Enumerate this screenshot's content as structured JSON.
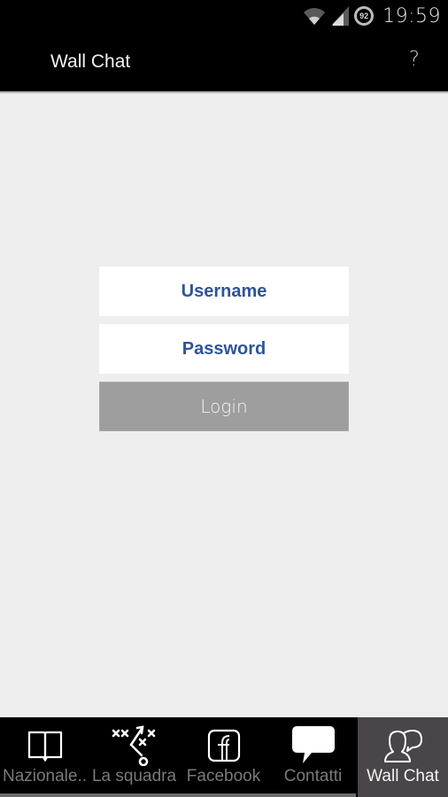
{
  "status_bar": {
    "time": "19:59",
    "battery_level": "92",
    "icons": [
      "wifi-icon",
      "cell-signal-icon",
      "battery-icon"
    ]
  },
  "action_bar": {
    "title": "Wall Chat",
    "help_label": "?"
  },
  "login": {
    "username_placeholder": "Username",
    "password_placeholder": "Password",
    "username_value": "",
    "password_value": "",
    "login_label": "Login"
  },
  "tabs": [
    {
      "label": "Nazionale..",
      "icon": "book-icon",
      "active": false
    },
    {
      "label": "La squadra",
      "icon": "playbook-icon",
      "active": false
    },
    {
      "label": "Facebook",
      "icon": "facebook-icon",
      "active": false
    },
    {
      "label": "Contatti",
      "icon": "speech-bubble-icon",
      "active": false
    },
    {
      "label": "Wall Chat",
      "icon": "users-chat-icon",
      "active": true
    }
  ],
  "colors": {
    "field_text": "#2e5597",
    "login_button_bg": "#9e9e9e",
    "active_tab_bg": "#4a4548",
    "background": "#eeeeee"
  }
}
